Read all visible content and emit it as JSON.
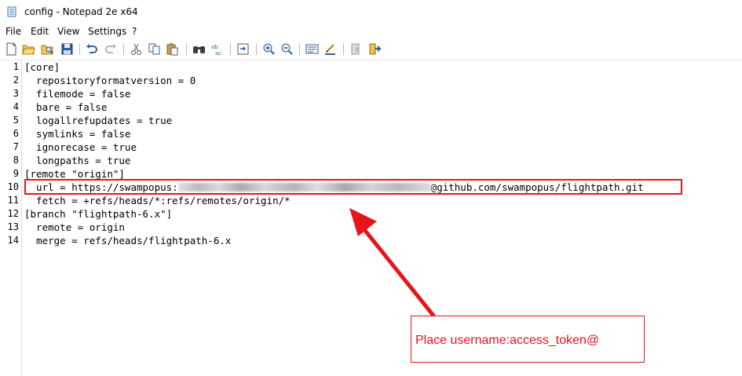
{
  "window": {
    "title": "config - Notepad 2e x64"
  },
  "menu": {
    "items": [
      "File",
      "Edit",
      "View",
      "Settings",
      "?"
    ]
  },
  "toolbar": {
    "buttons": [
      "new-file-icon",
      "open-file-icon",
      "browse-icon",
      "save-icon",
      "undo-icon",
      "redo-icon",
      "cut-icon",
      "copy-icon",
      "paste-icon",
      "find-icon",
      "replace-icon",
      "goto-icon",
      "zoom-in-icon",
      "zoom-out-icon",
      "settings-icon",
      "word-wrap-icon",
      "favorites-icon",
      "exit-icon"
    ]
  },
  "editor": {
    "line_numbers": [
      "1",
      "2",
      "3",
      "4",
      "5",
      "6",
      "7",
      "8",
      "9",
      "10",
      "11",
      "12",
      "13",
      "14"
    ],
    "lines": [
      "[core]",
      "  repositoryformatversion = 0",
      "  filemode = false",
      "  bare = false",
      "  logallrefupdates = true",
      "  symlinks = false",
      "  ignorecase = true",
      "  longpaths = true",
      "[remote \"origin\"]",
      "",
      "  fetch = +refs/heads/*:refs/remotes/origin/*",
      "[branch \"flightpath-6.x\"]",
      "  remote = origin",
      "  merge = refs/heads/flightpath-6.x"
    ],
    "url_line": {
      "prefix": "  url = https://swampopus:",
      "suffix": "@github.com/swampopus/flightpath.git"
    }
  },
  "annotation": {
    "note": "Place username:access_token@",
    "color": "#e8141c"
  }
}
